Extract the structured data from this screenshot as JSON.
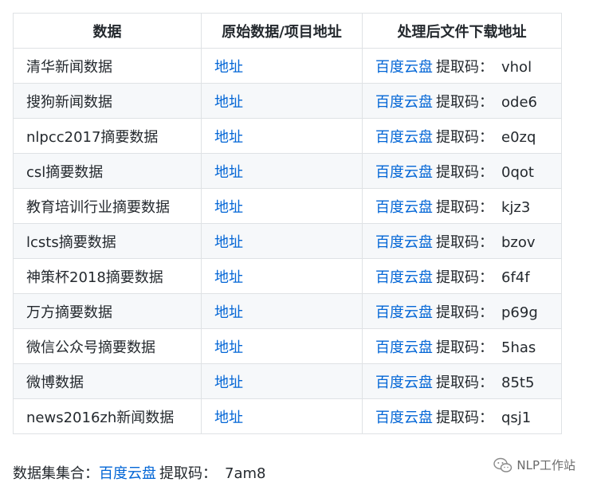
{
  "table": {
    "headers": [
      "数据",
      "原始数据/项目地址",
      "处理后文件下载地址"
    ],
    "link_label": "地址",
    "download_label": "百度云盘",
    "code_label": "提取码：",
    "rows": [
      {
        "name": "清华新闻数据",
        "code": "vhol"
      },
      {
        "name": "搜狗新闻数据",
        "code": "ode6"
      },
      {
        "name": "nlpcc2017摘要数据",
        "code": "e0zq"
      },
      {
        "name": "csl摘要数据",
        "code": "0qot"
      },
      {
        "name": "教育培训行业摘要数据",
        "code": "kjz3"
      },
      {
        "name": "lcsts摘要数据",
        "code": "bzov"
      },
      {
        "name": "神策杯2018摘要数据",
        "code": "6f4f"
      },
      {
        "name": "万方摘要数据",
        "code": "p69g"
      },
      {
        "name": "微信公众号摘要数据",
        "code": "5has"
      },
      {
        "name": "微博数据",
        "code": "85t5"
      },
      {
        "name": "news2016zh新闻数据",
        "code": "qsj1"
      }
    ]
  },
  "footer": {
    "label": "数据集集合：",
    "download_label": "百度云盘",
    "code_label": "提取码：",
    "code": "7am8"
  },
  "watermark": {
    "text": "NLP工作站",
    "icon": "wechat-icon"
  },
  "colors": {
    "link": "#0366d6",
    "border": "#dfe2e5",
    "stripe": "#f6f8fa",
    "text": "#24292e"
  }
}
